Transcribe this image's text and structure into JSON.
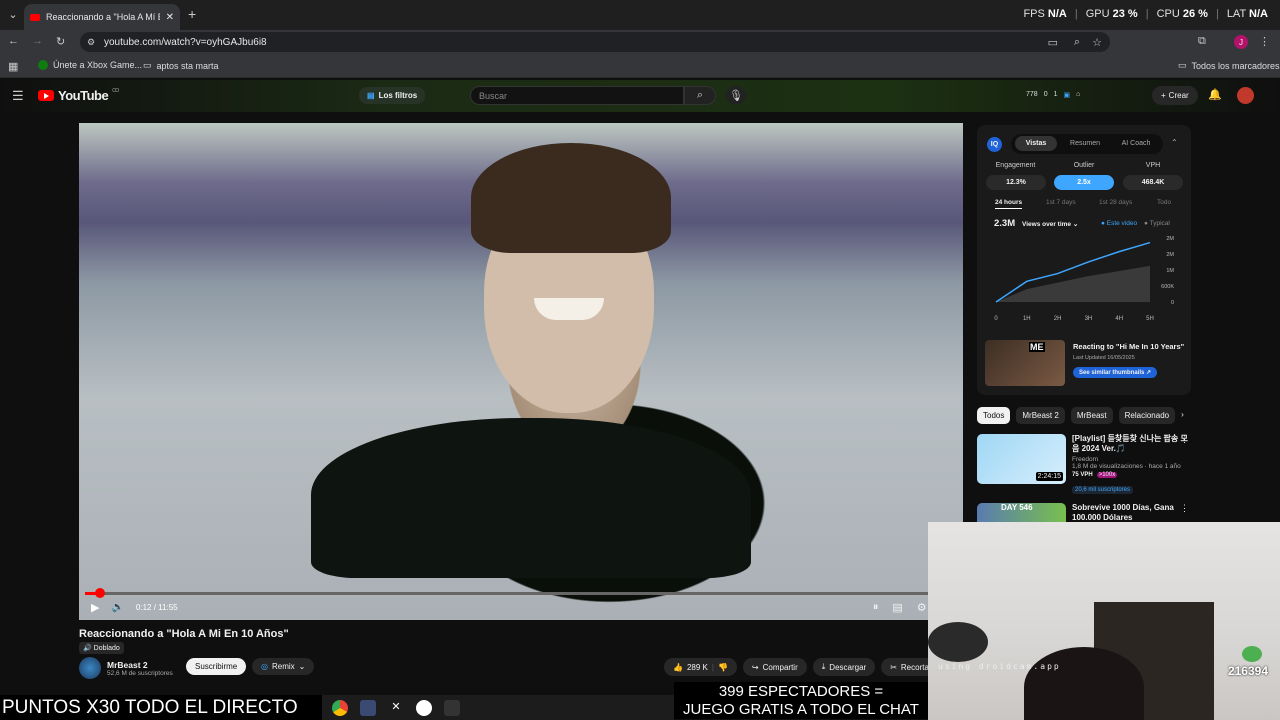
{
  "browser": {
    "tab_title": "Reaccionando a \"Hola A Mí En",
    "url": "youtube.com/watch?v=oyhGAJbu6i8",
    "perf": {
      "fps_label": "FPS",
      "fps": "N/A",
      "gpu_label": "GPU",
      "gpu": "23 %",
      "cpu_label": "CPU",
      "cpu": "26 %",
      "lat_label": "LAT",
      "lat": "N/A"
    },
    "bookmarks": [
      "Únete a Xbox Game...",
      "aptos sta marta"
    ],
    "all_bookmarks": "Todos los marcadores"
  },
  "youtube": {
    "logo": "YouTube",
    "logo_country": "CO",
    "filters": "Los filtros",
    "search_placeholder": "Buscar",
    "counts": {
      "a": "778",
      "b": "0",
      "c": "1"
    },
    "create": "Crear"
  },
  "video": {
    "time": "0:12 / 11:55",
    "progress": 0.017,
    "title": "Reaccionando a \"Hola A Mi En 10 Años\"",
    "dub": "Doblado",
    "channel": "MrBeast 2",
    "subs": "52,6 M de suscriptores",
    "subscribe": "Suscribirme",
    "remix": "Remix",
    "likes": "289 K",
    "share": "Compartir",
    "download": "Descargar",
    "clip": "Recorta"
  },
  "iq": {
    "logo": "IQ",
    "tabs": [
      "Vistas",
      "Resumen",
      "AI Coach"
    ],
    "metrics": [
      {
        "label": "Engagement",
        "value": "12.3%"
      },
      {
        "label": "Outlier",
        "value": "2.5x"
      },
      {
        "label": "VPH",
        "value": "468.4K"
      }
    ],
    "ranges": [
      "24 hours",
      "1st 7 days",
      "1st 28 days",
      "Todo"
    ],
    "views": "2.3M",
    "views_mode": "Views over time",
    "legend": [
      "Este video",
      "Typical"
    ],
    "reacting_title": "Reacting to \"Hi Me In 10 Years\"",
    "last_updated": "Last Updated 16/05/2025",
    "see_similar": "See similar thumbnails",
    "thumb_badge": "ME"
  },
  "chart_data": {
    "type": "area",
    "x": [
      "0",
      "1H",
      "2H",
      "3H",
      "4H",
      "5H"
    ],
    "series": [
      {
        "name": "Este video",
        "values": [
          0,
          0.8,
          1.1,
          1.55,
          1.95,
          2.3
        ]
      },
      {
        "name": "Typical",
        "values": [
          0,
          0.5,
          0.75,
          1.0,
          1.2,
          1.4
        ]
      }
    ],
    "yticks": [
      "0",
      "600K",
      "1M",
      "2M",
      "2M"
    ],
    "ylim": [
      0,
      2.4
    ]
  },
  "chips": [
    "Todos",
    "MrBeast 2",
    "MrBeast",
    "Relacionado"
  ],
  "recs": [
    {
      "title": "[Playlist] 듣찾듣찾 신나는 팝송 모음 2024 Ver.🎵",
      "channel": "Freedom",
      "meta": "1,8 M de visualizaciones · hace 1 año",
      "vph": "75 VPH",
      "tag": ">100x",
      "subs": "20,6 mil suscriptores",
      "duration": "2:24:15"
    },
    {
      "title": "Sobrevive 1000 Días, Gana 100.000 Dólares",
      "badge": "DAY 546"
    }
  ],
  "cam": {
    "watermark": "using droidcam.app",
    "number": "216394"
  },
  "overlay": {
    "ticker": "PUNTOS X30 TODO EL DIRECTO",
    "viewers_1": "399 ESPECTADORES =",
    "viewers_2": "JUEGO GRATIS A TODO EL CHAT"
  },
  "colors": {
    "accent": "#3ea6ff",
    "red": "#ff0000"
  }
}
